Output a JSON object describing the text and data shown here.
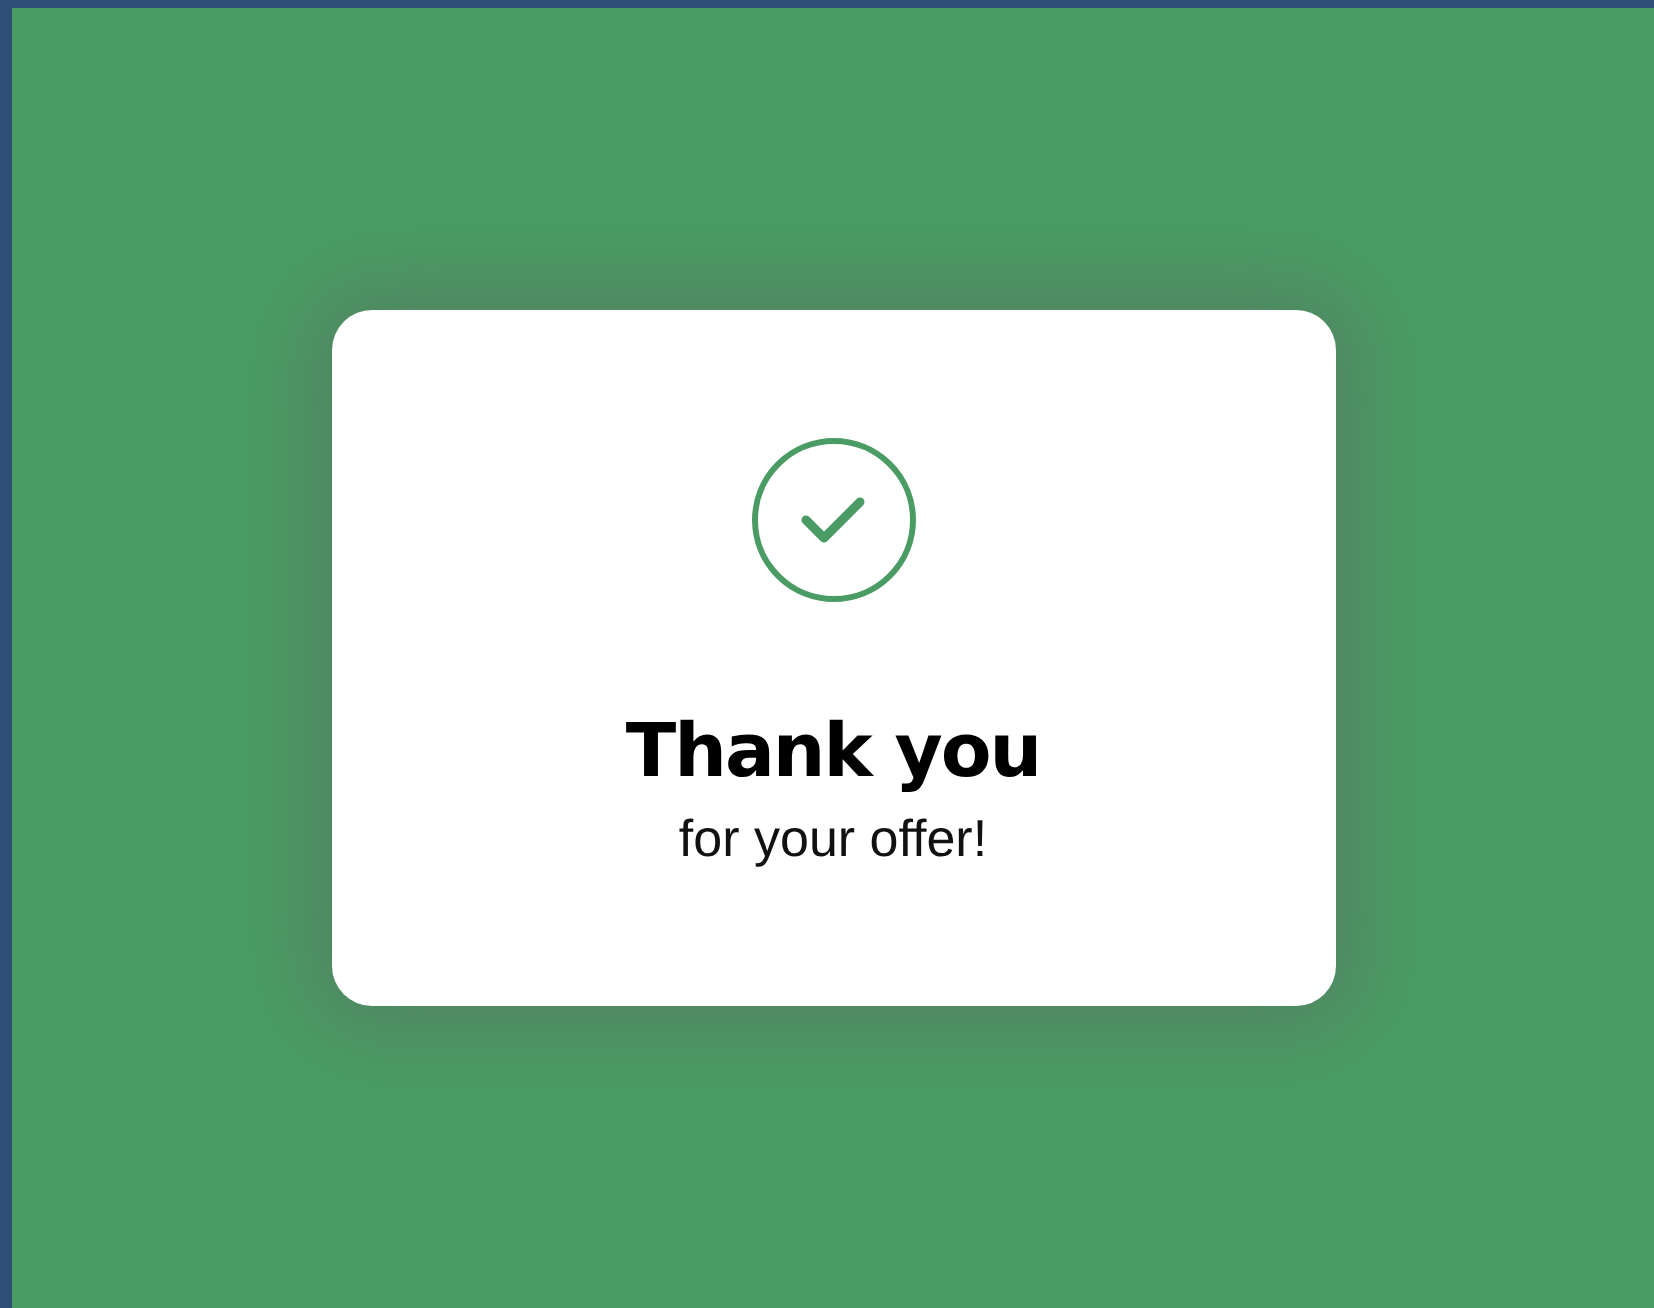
{
  "dialog": {
    "title": "Thank you",
    "message": "for your offer!"
  }
}
